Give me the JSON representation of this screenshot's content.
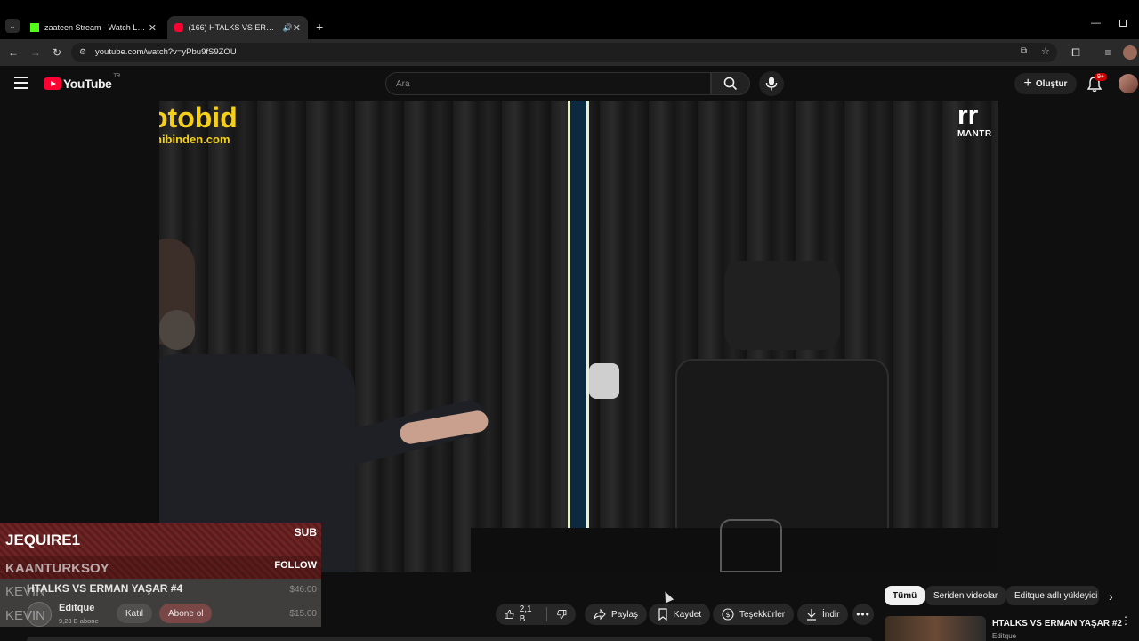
{
  "browser": {
    "tabs": [
      {
        "title": "zaateen Stream - Watch Live on",
        "favicon_color": "#53fc18"
      },
      {
        "title": "(166) HTALKS VS ERMAN YAŞAR",
        "favicon_color": "#ff0033"
      }
    ],
    "url": "youtube.com/watch?v=yPbu9fS9ZOU"
  },
  "youtube": {
    "logo": "YouTube",
    "region": "TR",
    "search_placeholder": "Ara",
    "create_label": "Oluştur",
    "notification_badge": "9+"
  },
  "video": {
    "logo_left_line1": "otobid",
    "logo_left_line2": "hibinden.com",
    "logo_right": "MANTR"
  },
  "overlay": {
    "sub_user": "JEQUIRE1",
    "sub_label": "SUB",
    "follow_user": "KAANTURKSOY",
    "follow_label": "FOLLOW",
    "donation1_user": "KEVIN",
    "donation1_amount": "$46.00",
    "donation2_user": "KEVIN",
    "donation2_amount": "$15.00"
  },
  "watch": {
    "title": "HTALKS VS ERMAN YAŞAR #4",
    "channel": "Editque",
    "subscribers": "9,23 B abone",
    "join_label": "Katıl",
    "subscribe_label": "Abone ol",
    "like_count": "2,1 B",
    "share_label": "Paylaş",
    "save_label": "Kaydet",
    "thanks_label": "Teşekkürler",
    "download_label": "İndir"
  },
  "filters": [
    "Tümü",
    "Seriden videolar",
    "Editque adlı yükleyici"
  ],
  "related": {
    "title": "HTALKS VS ERMAN YAŞAR #2",
    "channel": "Editque"
  }
}
